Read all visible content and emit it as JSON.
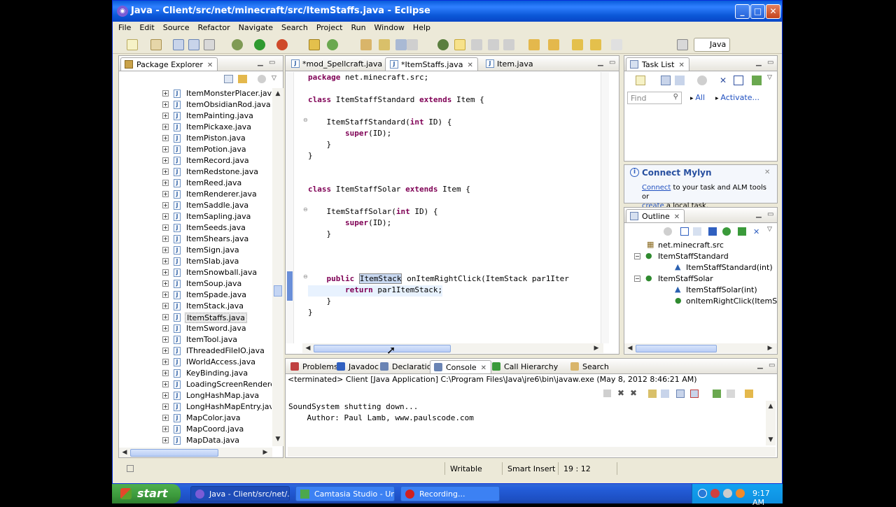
{
  "window": {
    "title": "Java - Client/src/net/minecraft/src/ItemStaffs.java - Eclipse",
    "minimize": "_",
    "maximize": "□",
    "close": "✕"
  },
  "menu": [
    "File",
    "Edit",
    "Source",
    "Refactor",
    "Navigate",
    "Search",
    "Project",
    "Run",
    "Window",
    "Help"
  ],
  "perspective": "Java",
  "package_explorer": {
    "title": "Package Explorer",
    "items": [
      "ItemMonsterPlacer.java",
      "ItemObsidianRod.java",
      "ItemPainting.java",
      "ItemPickaxe.java",
      "ItemPiston.java",
      "ItemPotion.java",
      "ItemRecord.java",
      "ItemRedstone.java",
      "ItemReed.java",
      "ItemRenderer.java",
      "ItemSaddle.java",
      "ItemSapling.java",
      "ItemSeeds.java",
      "ItemShears.java",
      "ItemSign.java",
      "ItemSlab.java",
      "ItemSnowball.java",
      "ItemSoup.java",
      "ItemSpade.java",
      "ItemStack.java",
      "ItemStaffs.java",
      "ItemSword.java",
      "ItemTool.java",
      "IThreadedFileIO.java",
      "IWorldAccess.java",
      "KeyBinding.java",
      "LoadingScreenRenderer.jav",
      "LongHashMap.java",
      "LongHashMapEntry.java",
      "MapColor.java",
      "MapCoord.java",
      "MapData.java"
    ],
    "selected_item": "ItemStaffs.java"
  },
  "editor": {
    "tabs": [
      {
        "label": "*mod_Spellcraft.java"
      },
      {
        "label": "*ItemStaffs.java"
      },
      {
        "label": "Item.java"
      }
    ],
    "lines": [
      [
        "package",
        " net.minecraft.src;"
      ],
      [
        "class",
        " ItemStaffStandard ",
        "extends",
        " Item {"
      ],
      [
        "    ItemStaffStandard(",
        "int",
        " ID) {"
      ],
      [
        "        ",
        "super",
        "(ID);"
      ],
      [
        "    }"
      ],
      [
        "}"
      ],
      [
        "class",
        " ItemStaffSolar ",
        "extends",
        " Item {"
      ],
      [
        "    ItemStaffSolar(",
        "int",
        " ID) {"
      ],
      [
        "        ",
        "super",
        "(ID);"
      ],
      [
        "    }"
      ],
      [
        "    ",
        "public",
        " ",
        "ItemStack",
        " onItemRightClick(ItemStack par1Iter"
      ],
      [
        "        ",
        "return",
        " par1ItemStack;"
      ],
      [
        "    }"
      ],
      [
        "}"
      ]
    ]
  },
  "task_list": {
    "title": "Task List",
    "find_placeholder": "Find",
    "all_label": "All",
    "activate_label": "Activate..."
  },
  "mylyn": {
    "title": "Connect Mylyn",
    "connect_link": "Connect",
    "text_1": " to your task and ALM tools or",
    "create_link": "create",
    "text_2": " a local task."
  },
  "outline": {
    "title": "Outline",
    "items": [
      "net.minecraft.src",
      "ItemStaffStandard",
      "ItemStaffStandard(int)",
      "ItemStaffSolar",
      "ItemStaffSolar(int)",
      "onItemRightClick(ItemStack, Wo"
    ]
  },
  "bottom_panel": {
    "tabs": [
      "Problems",
      "Javadoc",
      "Declaration",
      "Console",
      "Call Hierarchy",
      "Search"
    ],
    "active_tab": "Console",
    "terminated": "<terminated> Client [Java Application] C:\\Program Files\\Java\\jre6\\bin\\javaw.exe (May 8, 2012 8:46:21 AM)",
    "console_lines": [
      "SoundSystem shutting down...",
      "    Author: Paul Lamb, www.paulscode.com"
    ]
  },
  "status": {
    "writable": "Writable",
    "insert_mode": "Smart Insert",
    "position": "19 : 12"
  },
  "taskbar": {
    "start": "start",
    "tasks": [
      "Java - Client/src/net/...",
      "Camtasia Studio - Unt...",
      "Recording..."
    ],
    "clock": "9:17 AM"
  }
}
